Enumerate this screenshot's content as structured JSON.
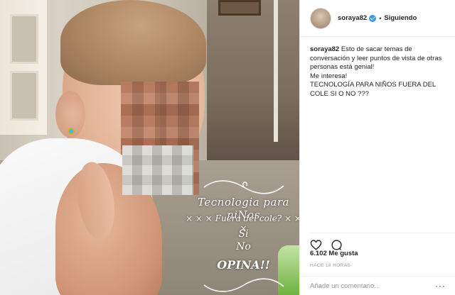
{
  "post": {
    "overlay": {
      "line1": "Tecnologia para niNos",
      "line2": "× × × Fuera del cole? × × ×",
      "line3": "Si",
      "line4": "No",
      "line5": "OPINA!!"
    }
  },
  "header": {
    "username": "soraya82",
    "separator": "•",
    "follow_status": "Siguiendo"
  },
  "caption": {
    "username": "soraya82",
    "lines": [
      "Esto de sacar temas de conversación y leer puntos de vista de otras personas está genial!",
      "Me interesa!",
      "TECNOLOGÍA PARA NIÑOS FUERA DEL COLE SI O NO ???"
    ]
  },
  "actions": {
    "like_icon": "heart-icon",
    "comment_icon": "comment-icon"
  },
  "likes": "6.102 Me gusta",
  "timestamp": "HACE 18 HORAS",
  "comment_box": {
    "placeholder": "Añade un comentario..."
  },
  "colors": {
    "verified": "#3897f0",
    "text": "#262626",
    "muted": "#999999",
    "border": "#efefef"
  }
}
